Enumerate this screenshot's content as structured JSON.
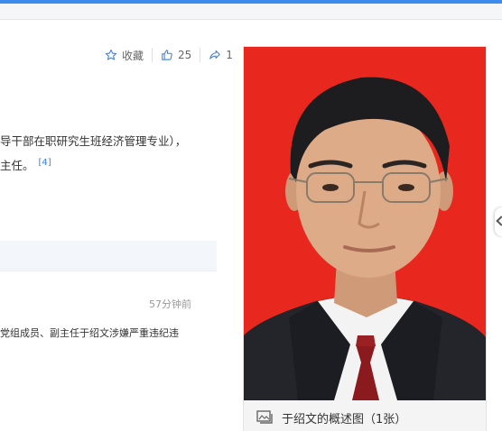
{
  "actions": {
    "favorite_label": "收藏",
    "like_count": "25",
    "share_count": "1"
  },
  "body_text": {
    "line1": "导干部在职研究生班经济管理专业），",
    "line2": "主任。",
    "ref": "[4]"
  },
  "news_panel": {
    "time": "57分钟前",
    "item": "党组成员、副主任于绍文涉嫌严重违纪违"
  },
  "photo_card": {
    "caption": "于绍文的概述图（1张）"
  },
  "colors": {
    "accent": "#3c8cf0",
    "photo_background": "#e8271e",
    "link": "#3c7fd8"
  }
}
